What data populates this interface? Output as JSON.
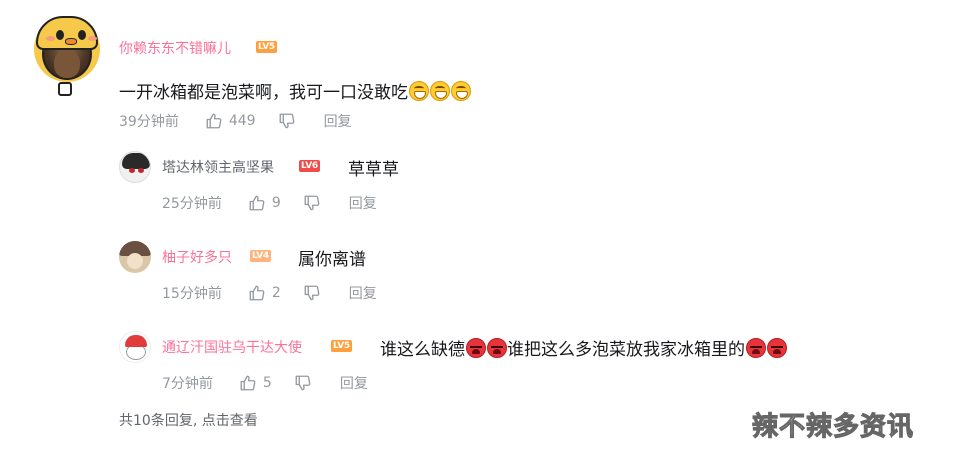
{
  "main_comment": {
    "username": "你赖东东不错嘛儿",
    "level": "LV5",
    "text": "一开冰箱都是泡菜啊，我可一口没敢吃",
    "emojis": [
      "grin",
      "grin",
      "grin"
    ],
    "time": "39分钟前",
    "likes": "449",
    "reply_label": "回复"
  },
  "replies": [
    {
      "username": "塔达林领主高坚果",
      "level": "LV6",
      "text": "草草草",
      "time": "25分钟前",
      "likes": "9",
      "reply_label": "回复"
    },
    {
      "username": "柚子好多只",
      "level": "LV4",
      "text": "属你离谱",
      "time": "15分钟前",
      "likes": "2",
      "reply_label": "回复"
    },
    {
      "username": "通辽汗国驻乌干达大使",
      "level": "LV5",
      "text_part1": "谁这么缺德",
      "text_part2": "谁把这么多泡菜放我家冰箱里的",
      "emojis": [
        "angry",
        "angry",
        "angry",
        "angry"
      ],
      "time": "7分钟前",
      "likes": "5",
      "reply_label": "回复"
    }
  ],
  "view_more": "共10条回复, 点击查看",
  "watermark": "辣不辣多资讯",
  "colors": {
    "username_pink": "#fb7299",
    "username_gray": "#61666d",
    "meta_gray": "#9499a0",
    "level5": "#ff9f3e",
    "level6": "#f04c49",
    "level4": "#ffb27a"
  }
}
